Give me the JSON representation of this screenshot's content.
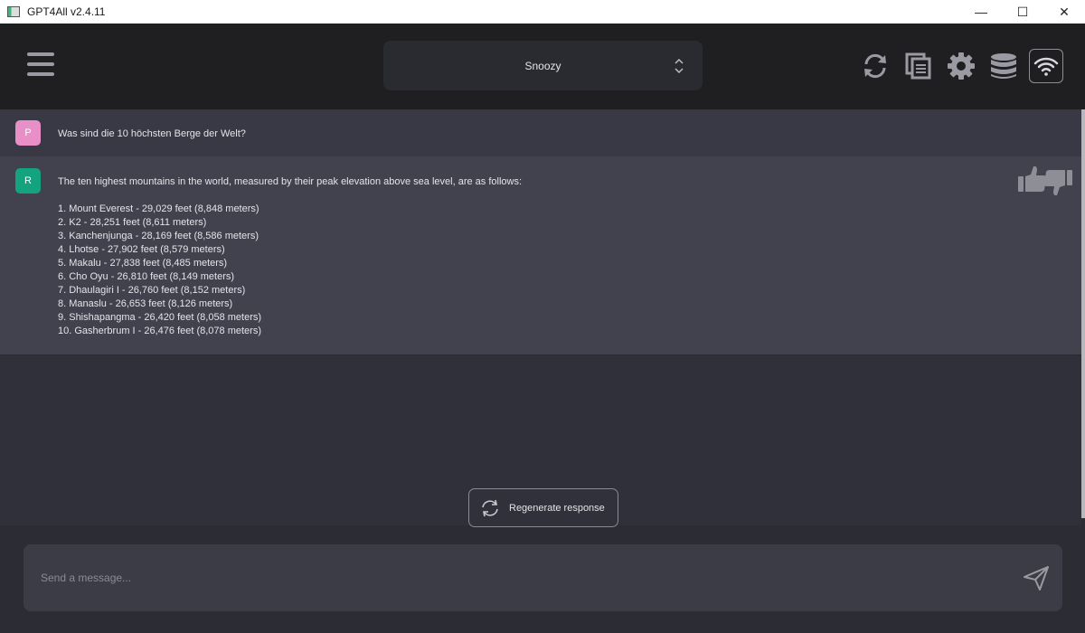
{
  "window": {
    "title": "GPT4All v2.4.11",
    "controls": {
      "minimize": "—",
      "maximize": "☐",
      "close": "✕"
    }
  },
  "header": {
    "model_selected": "Snoozy",
    "icons": [
      "menu-icon",
      "reset-chat-icon",
      "copy-chat-icon",
      "settings-icon",
      "localdocs-database-icon",
      "network-wifi-icon"
    ]
  },
  "chat": {
    "prompt": {
      "avatar": "P",
      "text": "Was sind die 10 höchsten Berge der Welt?"
    },
    "response": {
      "avatar": "R",
      "intro": "The ten highest mountains in the world, measured by their peak elevation above sea level, are as follows:",
      "items": [
        "1. Mount Everest - 29,029 feet (8,848 meters)",
        "2. K2 - 28,251 feet (8,611 meters)",
        "3. Kanchenjunga - 28,169 feet (8,586 meters)",
        "4. Lhotse - 27,902 feet (8,579 meters)",
        "5. Makalu - 27,838 feet (8,485 meters)",
        "6. Cho Oyu - 26,810 feet (8,149 meters)",
        "7. Dhaulagiri I - 26,760 feet (8,152 meters)",
        "8. Manaslu - 26,653 feet (8,126 meters)",
        "9. Shishapangma - 26,420 feet (8,058 meters)",
        "10. Gasherbrum I - 26,476 feet (8,078 meters)"
      ]
    }
  },
  "regenerate": {
    "label": "Regenerate response"
  },
  "input": {
    "placeholder": "Send a message...",
    "value": ""
  },
  "colors": {
    "header_bg": "#1f1f22",
    "chat_bg": "#2f3039",
    "prompt_bg": "#383944",
    "response_bg": "#41424d",
    "avatar_prompt": "#e88fc7",
    "avatar_response": "#14a37f",
    "icon_gray": "#9a9aa2"
  }
}
